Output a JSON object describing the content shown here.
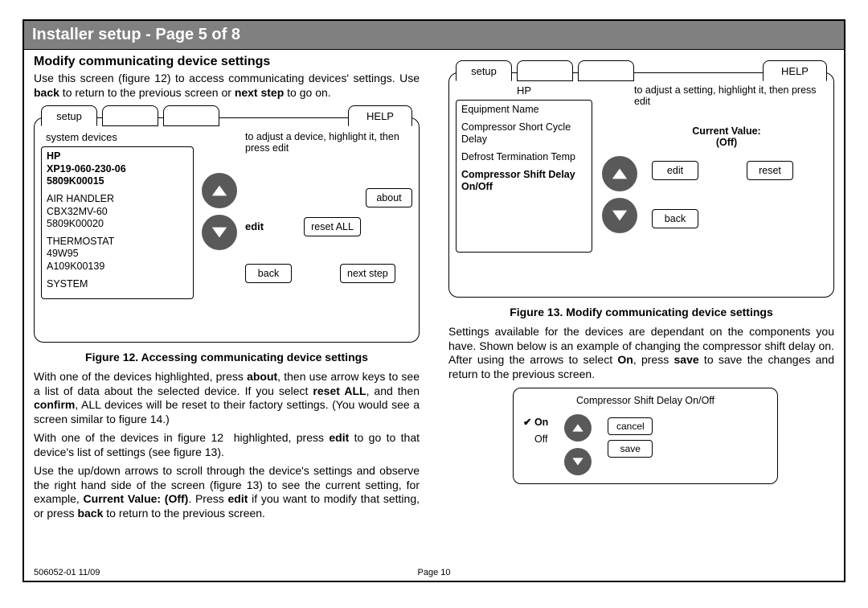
{
  "title_bar": "Installer setup - Page 5 of 8",
  "left": {
    "heading": "Modify communicating device settings",
    "intro_plain": "Use this screen (figure 12) to access communicating devices' settings. Use back to return to the previous screen or next step to go on.",
    "fig12": {
      "tab_setup": "setup",
      "tab_help": "HELP",
      "label_system_devices": "system devices",
      "hint": "to adjust a device, highlight it, then press edit",
      "devices": {
        "d1": {
          "l1": "HP",
          "l2": "XP19-060-230-06",
          "l3": "5809K00015"
        },
        "d2": {
          "l1": "AIR HANDLER",
          "l2": "CBX32MV-60",
          "l3": "5809K00020"
        },
        "d3": {
          "l1": "THERMOSTAT",
          "l2": "49W95",
          "l3": "A109K00139"
        },
        "d4": {
          "l1": "SYSTEM"
        }
      },
      "btn_about": "about",
      "btn_edit": "edit",
      "btn_resetall": "reset ALL",
      "btn_back": "back",
      "btn_next": "next step",
      "caption": "Figure 12. Accessing communicating device settings"
    },
    "para1_plain": "With one of the devices highlighted, press about, then use arrow keys to see a list of data about the selected device. If you select reset ALL, and then confirm, ALL devices will be reset to their factory settings. (You would see a screen similar to figure 14.)",
    "para2_plain": "With one of the devices in figure 12 highlighted, press edit to go to that device's list of settings (see figure 13).",
    "para3_plain": "Use the up/down arrows to scroll through the device's settings and observe the right hand side of the screen (figure 13) to see the current setting, for example, Current Value: (Off). Press edit if you want to modify that setting, or press back to return to the previous screen."
  },
  "right": {
    "fig13": {
      "tab_setup": "setup",
      "tab_help": "HELP",
      "hp_label": "HP",
      "hint": "to adjust a setting, highlight it, then press edit",
      "settings": {
        "s1": "Equipment Name",
        "s2": "Compressor Short Cycle Delay",
        "s3": "Defrost Termination Temp",
        "s4": "Compressor Shift Delay On/Off"
      },
      "value_label": "Current Value:",
      "value_value": "(Off)",
      "btn_edit": "edit",
      "btn_reset": "reset",
      "btn_back": "back",
      "caption": "Figure 13. Modify communicating device settings"
    },
    "para1_plain": "Settings available for the devices are dependant on the components you have. Shown below is an example of changing the compressor shift delay on. After using the arrows to select On, press save to save the changes and return to the previous screen.",
    "small": {
      "title": "Compressor Shift Delay On/Off",
      "opt_on": "On",
      "opt_off": "Off",
      "btn_cancel": "cancel",
      "btn_save": "save"
    }
  },
  "footer": {
    "left": "506052-01 11/09",
    "center": "Page 10"
  }
}
